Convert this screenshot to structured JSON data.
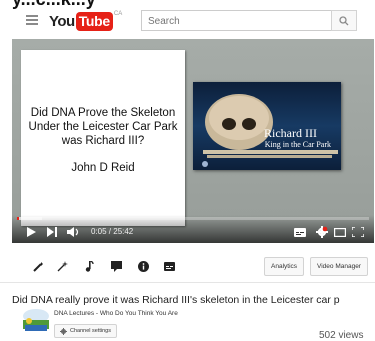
{
  "page_header": {
    "clipped_text": "y...c...k...y"
  },
  "masthead": {
    "logo_you": "You",
    "logo_tube": "Tube",
    "logo_ca": "CA",
    "search_placeholder": "Search"
  },
  "slide": {
    "card_title": "Did DNA Prove the Skeleton Under the Leicester Car Park was Richard III?",
    "card_author": "John D Reid",
    "photo_line1": "Richard III",
    "photo_line2": "King in the Car Park"
  },
  "player": {
    "time_display": "0:05 / 25:42",
    "progress_fraction": 0.0032,
    "loaded_fraction": 0.07
  },
  "tools": {
    "analytics_label": "Analytics",
    "video_manager_label": "Video Manager"
  },
  "video": {
    "title": "Did DNA really prove it was Richard III's skeleton in the Leicester car p",
    "channel_name": "DNA Lectures - Who Do You Think You Are",
    "channel_settings_label": "Channel settings",
    "views": "502 views"
  },
  "colors": {
    "brand_red": "#e62117"
  }
}
